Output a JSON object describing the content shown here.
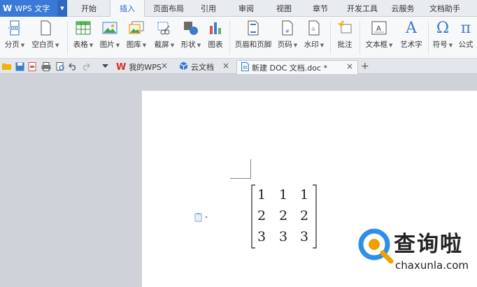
{
  "app": {
    "logo": "W",
    "title": "WPS 文字"
  },
  "menu_tabs": [
    "开始",
    "插入",
    "页面布局",
    "引用",
    "审阅",
    "视图",
    "章节",
    "开发工具",
    "云服务",
    "文档助手"
  ],
  "active_menu": "插入",
  "ribbon": {
    "page_break": "分页",
    "blank_page": "空白页",
    "table": "表格",
    "picture": "图片",
    "gallery": "图库",
    "screenshot": "截屏",
    "shape": "形状",
    "chart": "图表",
    "header_footer": "页眉和页脚",
    "page_number": "页码",
    "watermark": "水印",
    "comment": "批注",
    "textbox": "文本框",
    "wordart": "艺术字",
    "symbol": "符号",
    "formula": "公式",
    "symbol_glyph": "Ω",
    "formula_glyph": "π",
    "wordart_glyph": "A"
  },
  "doc_tabs": [
    {
      "label": "我的WPS",
      "close": "×"
    },
    {
      "label": "云文档",
      "close": "×"
    },
    {
      "label": "新建 DOC 文档.doc *",
      "close": "×"
    }
  ],
  "add_tab": "+",
  "matrix": [
    [
      "1",
      "1",
      "1"
    ],
    [
      "2",
      "2",
      "2"
    ],
    [
      "3",
      "3",
      "3"
    ]
  ],
  "watermark": {
    "text": "查询啦",
    "url": "chaxunla.com",
    "color": "#2f8fe6"
  },
  "colors": {
    "accent": "#3a7ad6",
    "ribbon_bg": "#f7f8fa",
    "workspace": "#cfd3d9"
  }
}
